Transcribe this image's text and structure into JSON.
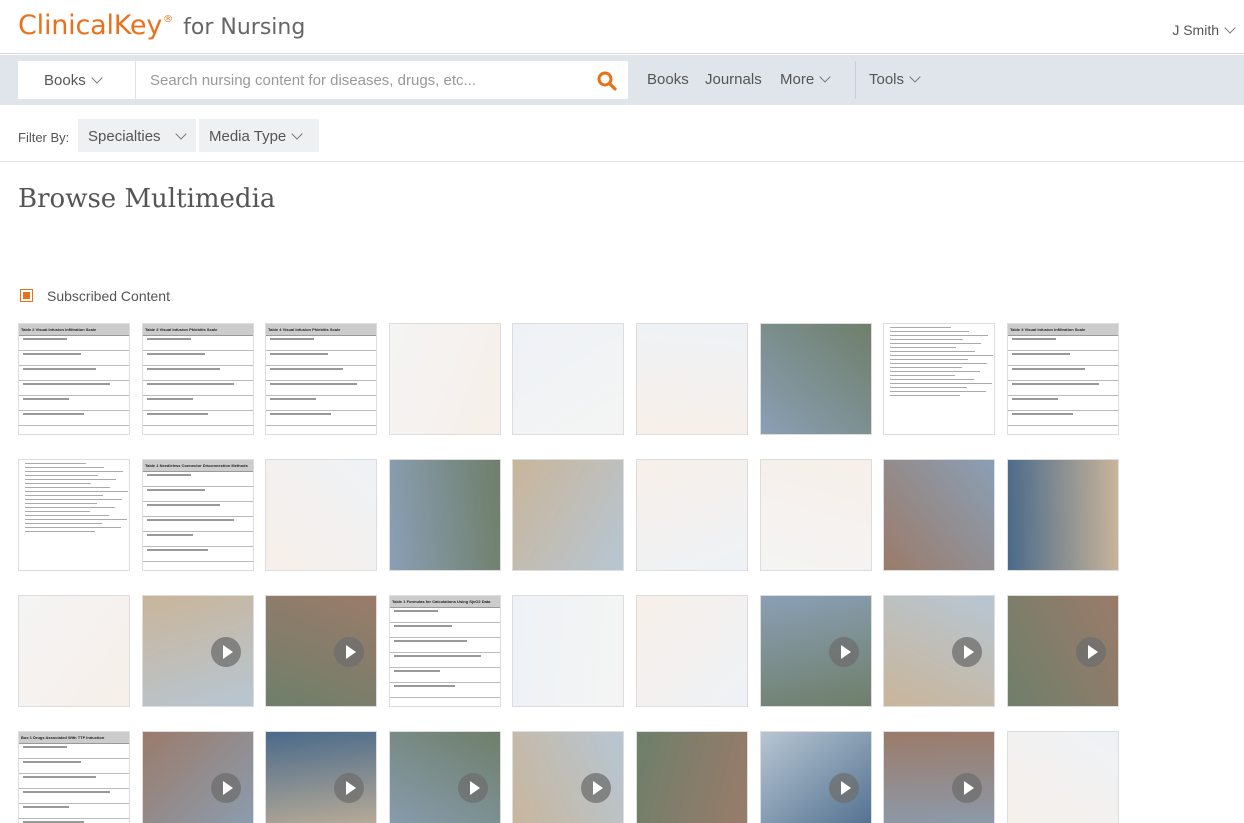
{
  "header": {
    "brand": "ClinicalKey",
    "reg_mark": "®",
    "product": "for Nursing",
    "user": "J Smith"
  },
  "search": {
    "scope_label": "Books",
    "placeholder": "Search nursing content for diseases, drugs, etc...",
    "value": ""
  },
  "nav": {
    "books": "Books",
    "journals": "Journals",
    "more": "More",
    "tools": "Tools"
  },
  "filter": {
    "label": "Filter By:",
    "specialties": "Specialties",
    "media_type": "Media Type"
  },
  "page": {
    "title": "Browse Multimedia",
    "subscribed_label": "Subscribed Content"
  },
  "colors": {
    "brand": "#e9711c",
    "search_bar": "#dfe5ea"
  },
  "thumbnails": [
    {
      "kind": "table",
      "title": "Table 2   Visual Infusion Infiltration Scale",
      "video": false
    },
    {
      "kind": "table",
      "title": "Table 3   Visual Infusion Phlebitis Scale",
      "video": false
    },
    {
      "kind": "table",
      "title": "Table 4   Visual Infusion Phlebitis Scale",
      "video": false
    },
    {
      "kind": "illustration",
      "title": "",
      "video": false
    },
    {
      "kind": "illustration",
      "title": "",
      "video": false
    },
    {
      "kind": "illustration",
      "title": "",
      "video": false
    },
    {
      "kind": "photo",
      "title": "",
      "video": false
    },
    {
      "kind": "document",
      "title": "",
      "video": false
    },
    {
      "kind": "table",
      "title": "Table 3   Visual Infusion Infiltration Scale",
      "video": false
    },
    {
      "kind": "document",
      "title": "",
      "video": false
    },
    {
      "kind": "table",
      "title": "Table 1   Needleless Connector Disconnection Methods",
      "video": false
    },
    {
      "kind": "illustration",
      "title": "",
      "video": false
    },
    {
      "kind": "photo",
      "title": "",
      "video": false
    },
    {
      "kind": "photo",
      "title": "",
      "video": false
    },
    {
      "kind": "illustration",
      "title": "",
      "video": false
    },
    {
      "kind": "illustration",
      "title": "",
      "video": false
    },
    {
      "kind": "photo",
      "title": "",
      "video": false
    },
    {
      "kind": "photo",
      "title": "",
      "video": false
    },
    {
      "kind": "illustration",
      "title": "",
      "video": false
    },
    {
      "kind": "photo",
      "title": "",
      "video": true
    },
    {
      "kind": "photo",
      "title": "",
      "video": true
    },
    {
      "kind": "table",
      "title": "Table 1   Formulas for Calculations Using SjvO2 Data",
      "video": false
    },
    {
      "kind": "illustration",
      "title": "",
      "video": false
    },
    {
      "kind": "illustration",
      "title": "",
      "video": false
    },
    {
      "kind": "photo",
      "title": "",
      "video": true
    },
    {
      "kind": "photo",
      "title": "",
      "video": true
    },
    {
      "kind": "photo",
      "title": "",
      "video": true
    },
    {
      "kind": "table",
      "title": "Box 1   Drugs Associated With TTP Induction",
      "video": false
    },
    {
      "kind": "photo",
      "title": "",
      "video": true
    },
    {
      "kind": "photo",
      "title": "",
      "video": true
    },
    {
      "kind": "photo",
      "title": "",
      "video": true
    },
    {
      "kind": "photo",
      "title": "",
      "video": true
    },
    {
      "kind": "photo",
      "title": "",
      "video": false
    },
    {
      "kind": "photo",
      "title": "",
      "video": true
    },
    {
      "kind": "photo",
      "title": "",
      "video": true
    },
    {
      "kind": "illustration",
      "title": "",
      "video": false
    }
  ]
}
